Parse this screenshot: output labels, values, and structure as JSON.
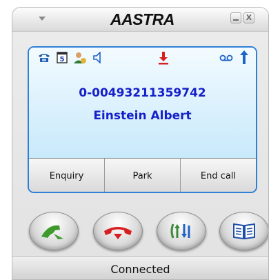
{
  "titlebar": {
    "brand": "AASTRA",
    "menu_icon": "chevron-down-icon",
    "minimize_icon": "minimize-icon",
    "close_icon": "close-icon",
    "close_glyph": "X"
  },
  "display": {
    "status_icons": [
      "phone-icon",
      "calendar-icon",
      "presence-icon",
      "speaker-icon",
      "hold-icon",
      "voicemail-icon",
      "arrow-up-icon"
    ],
    "calendar_digit": "5",
    "number": "0-00493211359742",
    "name": "Einstein Albert"
  },
  "softkeys": [
    "Enquiry",
    "Park",
    "End call"
  ],
  "action_buttons": {
    "answer_icon": "answer-call-icon",
    "hangup_icon": "hangup-icon",
    "transfer_icon": "transfer-icon",
    "phonebook_icon": "phonebook-icon"
  },
  "status": {
    "text": "Connected"
  },
  "colors": {
    "accent": "#2f7fd8",
    "caller_text": "#1520c8",
    "answer_green": "#3f9a2d",
    "hangup_red": "#d81f1f",
    "icon_blue": "#1e64c8"
  }
}
